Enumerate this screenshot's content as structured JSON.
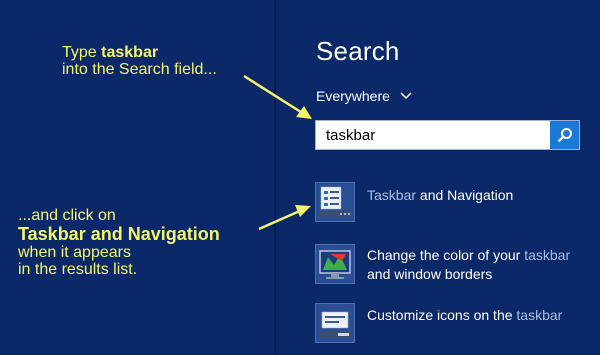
{
  "notes": {
    "note1_prefix": "Type ",
    "note1_bold": "taskbar",
    "note1_line2": "into the Search field...",
    "note2_line1": "...and click on",
    "note2_bold": "Taskbar and Navigation",
    "note2_line3": "when it appears",
    "note2_line4": "in the results list."
  },
  "search": {
    "title": "Search",
    "scope_label": "Everywhere",
    "input_value": "taskbar"
  },
  "results": [
    {
      "highlight": "Taskbar",
      "text": " and Navigation",
      "icon": "taskbar-settings-icon"
    },
    {
      "line1_text": "Change the color of your ",
      "line1_highlight": "taskbar",
      "line2": "and window borders",
      "icon": "color-settings-icon"
    },
    {
      "text": "Customize icons on the ",
      "highlight": "taskbar",
      "icon": "notification-icons-icon"
    }
  ],
  "colors": {
    "background": "#0b2868",
    "annotation": "#f6f56a",
    "search_button": "#1a78d6",
    "highlight_text": "#a9bce4"
  }
}
